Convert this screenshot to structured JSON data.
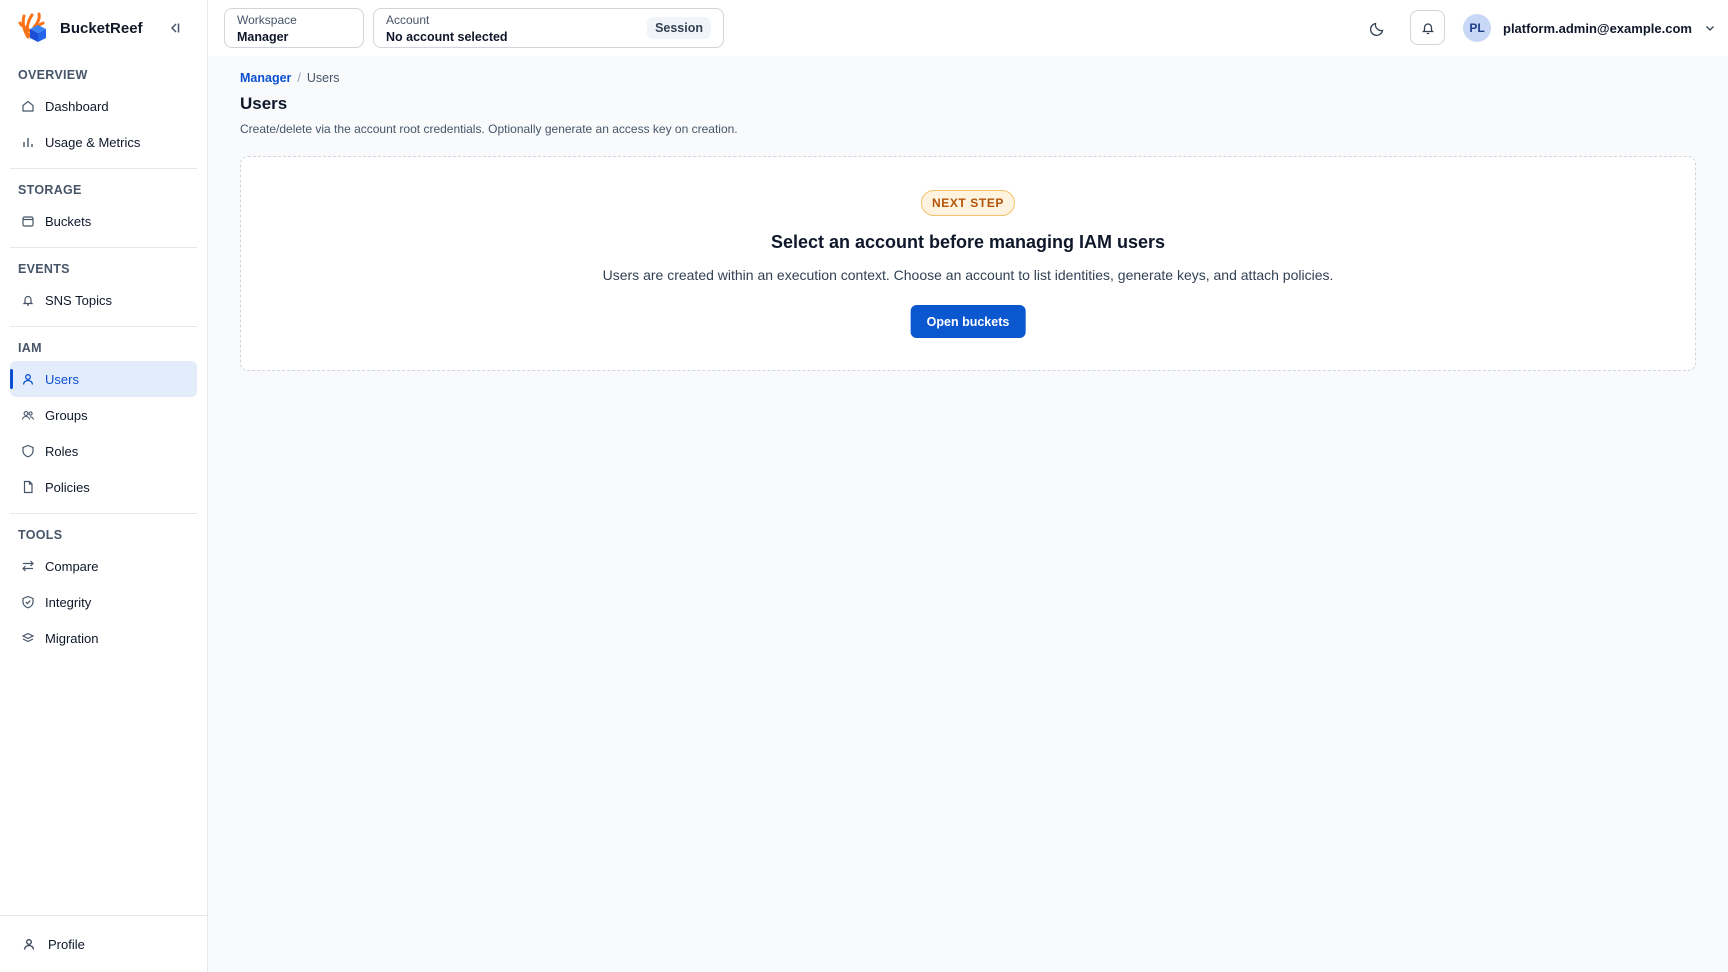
{
  "app": {
    "name": "BucketReef",
    "colors": {
      "accent": "#0b57d0",
      "active_bg": "#e3ecfb",
      "badge_text": "#b45309",
      "badge_bg": "#fdf3df"
    }
  },
  "sidebar": {
    "sections": [
      {
        "title": "OVERVIEW",
        "items": [
          {
            "label": "Dashboard",
            "icon": "home-icon"
          },
          {
            "label": "Usage & Metrics",
            "icon": "bar-chart-icon"
          }
        ]
      },
      {
        "title": "STORAGE",
        "items": [
          {
            "label": "Buckets",
            "icon": "bucket-icon"
          }
        ]
      },
      {
        "title": "EVENTS",
        "items": [
          {
            "label": "SNS Topics",
            "icon": "bell-icon"
          }
        ]
      },
      {
        "title": "IAM",
        "items": [
          {
            "label": "Users",
            "icon": "user-icon",
            "active": true
          },
          {
            "label": "Groups",
            "icon": "users-icon"
          },
          {
            "label": "Roles",
            "icon": "shield-icon"
          },
          {
            "label": "Policies",
            "icon": "file-icon"
          }
        ]
      },
      {
        "title": "TOOLS",
        "items": [
          {
            "label": "Compare",
            "icon": "compare-icon"
          },
          {
            "label": "Integrity",
            "icon": "shield-check-icon"
          },
          {
            "label": "Migration",
            "icon": "migration-icon"
          }
        ]
      }
    ],
    "footer": {
      "label": "Profile",
      "icon": "user-icon"
    }
  },
  "topbar": {
    "workspace": {
      "label": "Workspace",
      "value": "Manager"
    },
    "account": {
      "label": "Account",
      "value": "No account selected",
      "chip": "Session"
    },
    "user": {
      "initials": "PL",
      "email": "platform.admin@example.com"
    }
  },
  "breadcrumb": {
    "parent": "Manager",
    "separator": "/",
    "current": "Users"
  },
  "page": {
    "title": "Users",
    "description": "Create/delete via the account root credentials. Optionally generate an access key on creation."
  },
  "empty_state": {
    "badge": "NEXT STEP",
    "title": "Select an account before managing IAM users",
    "description": "Users are created within an execution context. Choose an account to list identities, generate keys, and attach policies.",
    "button": "Open buckets"
  }
}
